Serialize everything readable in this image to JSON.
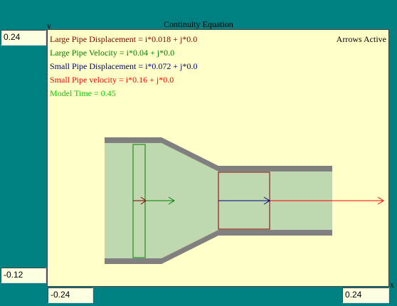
{
  "title": "Continuity Equation",
  "axes": {
    "y_letter": "y",
    "x_letter": "x"
  },
  "fields": {
    "y_max": "0.24",
    "y_min": "-0.12",
    "x_min": "-0.24",
    "x_max": "0.24"
  },
  "status": "Arrows Active",
  "readouts": [
    {
      "name": "large-pipe-displacement",
      "text": "Large Pipe Displacement = i*0.018 + j*0.0",
      "color": "#800000"
    },
    {
      "name": "large-pipe-velocity",
      "text": "Large Pipe Velocity = i*0.04 + j*0.0",
      "color": "#008000"
    },
    {
      "name": "small-pipe-displacement",
      "text": "Small Pipe Displacement = i*0.072 + j*0.0",
      "color": "#000080"
    },
    {
      "name": "small-pipe-velocity",
      "text": "Small Pipe velocity = i*0.16 + j*0.0",
      "color": "#ff0000"
    },
    {
      "name": "model-time",
      "text": "Model Time = 0.45",
      "color": "#00cc00"
    }
  ],
  "colors": {
    "background": "#008080",
    "panel": "#ffffc8",
    "fluid": "#c0d8b0",
    "pipe_wall": "#808080",
    "large_pipe": "#800000",
    "large_velocity": "#008000",
    "small_pipe": "#000080",
    "small_velocity": "#ff0000"
  }
}
